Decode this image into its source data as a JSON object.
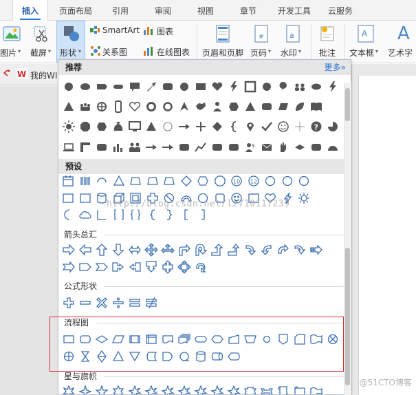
{
  "tabs": [
    {
      "label": "插入",
      "active": true
    },
    {
      "label": "页面布局"
    },
    {
      "label": "引用"
    },
    {
      "label": "审阅"
    },
    {
      "label": "视图"
    },
    {
      "label": "章节"
    },
    {
      "label": "开发工具"
    },
    {
      "label": "云服务"
    }
  ],
  "ribbon": {
    "picture_label": "图片",
    "screenshot_label": "截屏",
    "shape_label": "形状",
    "smartart_label": "SmartArt",
    "chart_label": "图表",
    "relation_label": "关系图",
    "online_chart_label": "在线图表",
    "header_footer_label": "页眉和页脚",
    "page_number_label": "页码",
    "watermark_label": "水印",
    "annotation_label": "批注",
    "textbox_label": "文本框",
    "wordart_label": "艺术字"
  },
  "doc_tab": {
    "label": "我的WI"
  },
  "panel": {
    "recommended_title": "推荐",
    "more_label": "更多»",
    "preset_title": "预设",
    "arrows_title": "箭头总汇",
    "formula_title": "公式形状",
    "flowchart_title": "流程图",
    "stars_title": "星与旗帜"
  },
  "recommended_rows": [
    [
      "circle",
      "oval",
      "rect-tag",
      "rounded-pill",
      "callout-rect",
      "arrow-diag",
      "round-rect",
      "circle",
      "rect",
      "heart",
      "lightning",
      "frame",
      "circle",
      "balloon",
      "people",
      "ellipse",
      "lightning"
    ],
    [
      "triangle",
      "crowd",
      "globe",
      "phone",
      "heart-outline",
      "donut",
      "circle-thick",
      "arrow-up-curve",
      "map-china",
      "person",
      "hexagon",
      "triangle",
      "round-rect",
      "parallelogram",
      "leaf",
      "book"
    ],
    [
      "sun",
      "octagon",
      "hexagon",
      "moneybag",
      "monitor",
      "triangle",
      "circle-outline",
      "arrow-right",
      "plus",
      "diamond",
      "brace-left",
      "pin",
      "check",
      "smiley",
      "cross-thin",
      "question",
      "pie"
    ],
    [
      "laptop",
      "corner",
      "round-rect",
      "chart-bars",
      "group",
      "arrow-right",
      "arrow-right",
      "round-rect",
      "line-chart",
      "round-rect",
      "round-rect",
      "dollar-person",
      "envelope-ribbon",
      "hand",
      "diamond-flat",
      "round-rect",
      "semicircle"
    ]
  ],
  "preset_rows": [
    [
      "calendar",
      "barcode",
      "arc-circle",
      "triangle-outline",
      "trapezoid",
      "trapezoid",
      "trapezoid",
      "diamond-outline",
      "hexagon-outline",
      "octagon-outline",
      "ten",
      "twelve",
      "circle-outline",
      "circle-outline",
      "circle-outline"
    ],
    [
      "rect-outline",
      "rect-outline",
      "can",
      "cube",
      "frame-outline",
      "plus-outline",
      "no-symbol",
      "block-arc",
      "circle-outline",
      "square-outline",
      "smiley-outline",
      "rect-outline",
      "heart-outline",
      "sun-outline",
      "gear"
    ],
    [
      "moon",
      "cloud",
      "corner-l",
      "brackets",
      "braces",
      "brace-l",
      "brace-r",
      "bracket-l",
      "bracket-r"
    ]
  ],
  "arrow_rows": [
    [
      "arrow-right-o",
      "arrow-left-o",
      "arrow-up-o",
      "arrow-down-o",
      "arrow-lr-o",
      "arrow-4way-o",
      "arrow-3way-o",
      "arrow-bent-o",
      "arrow-uturn-o",
      "arrow-lup-o",
      "arrow-bent-up-o",
      "arrow-curve-r-o",
      "arrow-curve-l-o",
      "arrow-curve-u-o",
      "arrow-curve-d-o",
      "arrow-striped-o"
    ],
    [
      "arrow-notched-o",
      "pentagon-o",
      "chevron-o",
      "callout-r-o",
      "callout-l-o",
      "callout-d-o",
      "callout-ud-o",
      "callout-4-o",
      "circular-arrow-o"
    ]
  ],
  "formula_row": [
    "plus-o",
    "minus-o",
    "multiply-o",
    "divide-o",
    "equal-o",
    "notequal-o"
  ],
  "flowchart_rows": [
    [
      "process",
      "alt-process",
      "decision",
      "data",
      "predefined",
      "internal-storage",
      "document",
      "multidoc",
      "terminator",
      "preparation",
      "manual-input",
      "manual-op",
      "connector",
      "off-page",
      "card",
      "punched-tape",
      "summing"
    ],
    [
      "or",
      "collate",
      "sort",
      "extract",
      "merge",
      "stored-data",
      "delay",
      "seq-access",
      "magnetic-disk",
      "direct-access",
      "display"
    ]
  ],
  "stars_row": [
    "starburst",
    "star4",
    "star5",
    "star6",
    "star7",
    "star8",
    "star10",
    "star12",
    "star16",
    "star24",
    "star32",
    "ribbon-up",
    "ribbon-down",
    "scroll-v",
    "scroll-h",
    "wave"
  ],
  "watermark_text": "http://blog.csdn.net/lz710117239",
  "credit_text": "@51CTO博客",
  "colors": {
    "accent": "#2a7ad5",
    "shape_fill": "#555555",
    "shape_outline": "#3c6fb3",
    "highlight": "#d9282f"
  }
}
